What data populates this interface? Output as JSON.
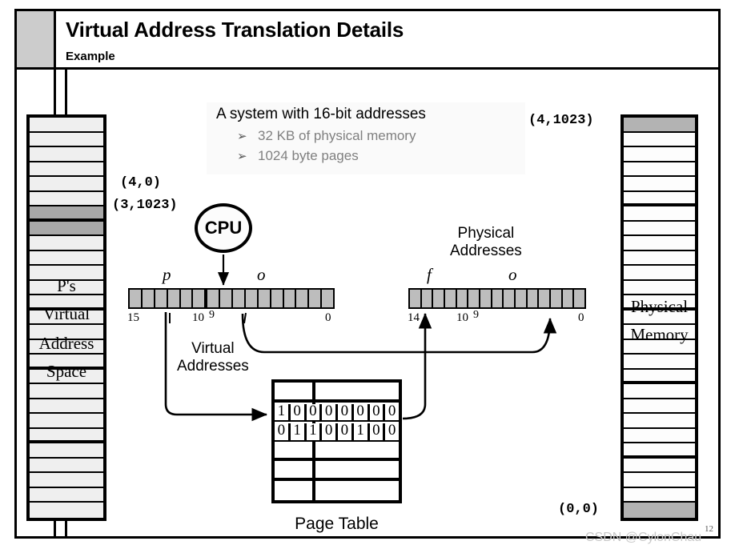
{
  "header": {
    "title": "Virtual Address Translation Details",
    "subtitle": "Example",
    "gray_block_color": "#cccccc"
  },
  "info_box": {
    "title": "A system with 16-bit addresses",
    "bullet_marker": "➢",
    "bullets": [
      "32 KB of physical memory",
      "1024 byte pages"
    ],
    "title_color": "#000000",
    "bullet_color": "#808080"
  },
  "coordinates": {
    "top_right": "(4,1023)",
    "left_upper": "(4,0)",
    "left_lower": "(3,1023)",
    "bottom_right": "(0,0)"
  },
  "cpu": {
    "label": "CPU"
  },
  "virtual_address": {
    "field_left": "p",
    "field_right": "o",
    "bit_high": "15",
    "bit_split_high": "10",
    "bit_split_low": "9",
    "bit_low": "0",
    "total_bits": 16,
    "split_after": 6,
    "caption_line1": "Virtual",
    "caption_line2": "Addresses"
  },
  "physical_address": {
    "field_left": "f",
    "field_right": "o",
    "bit_high": "14",
    "bit_split_high": "10",
    "bit_split_low": "9",
    "bit_low": "0",
    "total_bits": 15,
    "caption_line1": "Physical",
    "caption_line2": "Addresses"
  },
  "page_table": {
    "caption": "Page Table",
    "rows": 6,
    "entry_rows": [
      {
        "index": 1,
        "bits": [
          "1",
          "0",
          "0",
          "0",
          "0",
          "0",
          "0",
          "0"
        ]
      },
      {
        "index": 2,
        "bits": [
          "0",
          "1",
          "1",
          "0",
          "0",
          "1",
          "0",
          "0"
        ]
      }
    ]
  },
  "virtual_memory_column": {
    "label_lines": [
      "P's",
      "Virtual",
      "Address",
      "Space"
    ],
    "total_cells": 27,
    "shaded_cells": [
      6,
      7
    ],
    "thick_separator_after": [
      6,
      12,
      16,
      21
    ],
    "cell_color": "#efefef",
    "shaded_color": "#a8a8a8"
  },
  "physical_memory_column": {
    "label_lines": [
      "Physical",
      "Memory"
    ],
    "total_cells": 27,
    "shaded_cells": [
      0,
      26
    ],
    "thick_separator_after": [
      5,
      12,
      17,
      22
    ],
    "cell_color": "#fdfdfd",
    "shaded_color": "#b3b3b3"
  },
  "footer": {
    "watermark": "CSDN @CylonChau",
    "page_number": "12"
  }
}
